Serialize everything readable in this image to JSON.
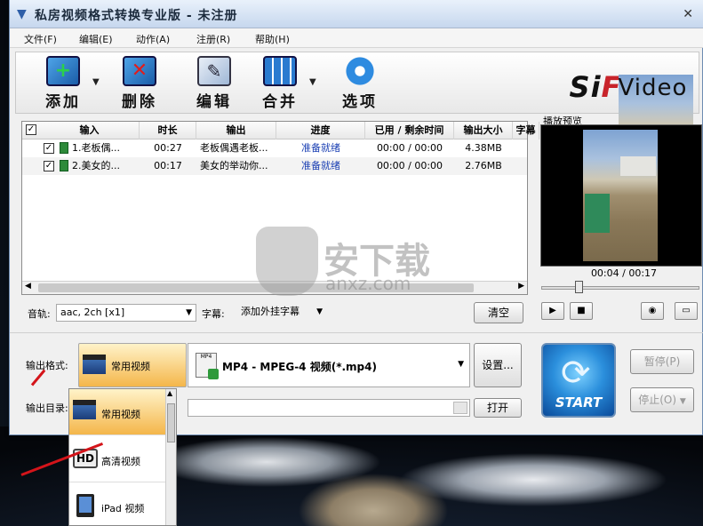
{
  "window": {
    "title": "私房视频格式转换专业版 - 未注册",
    "close_glyph": "✕"
  },
  "menu": [
    "文件(F)",
    "编辑(E)",
    "动作(A)",
    "注册(R)",
    "帮助(H)"
  ],
  "toolbar": {
    "add_label": "添加",
    "delete_label": "删除",
    "edit_label": "编辑",
    "merge_label": "合并",
    "options_label": "选项",
    "dropdown_glyph": "▼"
  },
  "brand": {
    "si": "Si",
    "fang": "Fang",
    "video": "Video"
  },
  "table": {
    "headers": [
      "输入",
      "时长",
      "输出",
      "进度",
      "已用 / 剩余时间",
      "输出大小",
      "字幕"
    ],
    "rows": [
      {
        "input": "1.老板偶...",
        "duration": "00:27",
        "output": "老板偶遇老板...",
        "status": "准备就绪",
        "time": "00:00 / 00:00",
        "size": "4.38MB"
      },
      {
        "input": "2.美女的...",
        "duration": "00:17",
        "output": "美女的举动你...",
        "status": "准备就绪",
        "time": "00:00 / 00:00",
        "size": "2.76MB"
      }
    ]
  },
  "preview": {
    "label": "播放预览",
    "time": "00:04 / 00:17"
  },
  "audio": {
    "label": "音轨:",
    "value": "aac, 2ch [x1]"
  },
  "subtitle": {
    "label": "字幕:",
    "value": "添加外挂字幕"
  },
  "buttons": {
    "clear": "清空",
    "settings": "设置...",
    "open": "打开",
    "pause": "暂停(P)",
    "stop": "停止(O)",
    "start": "START"
  },
  "format": {
    "label": "输出格式:",
    "category": "常用视频",
    "format": "MP4 - MPEG-4 视频(*.mp4)",
    "mp4_icon_text": "MP4"
  },
  "output_dir": {
    "label": "输出目录:"
  },
  "dropdown_items": [
    "常用视频",
    "高清视频",
    "iPad 视频"
  ],
  "hd_badge": "HD",
  "watermark": {
    "main": "安下载",
    "sub": "anxz.com"
  },
  "colors": {
    "accent": "#f4b64a",
    "status": "#1a3fb3",
    "start": "#2b8fdc",
    "arrow": "#d4141a"
  }
}
